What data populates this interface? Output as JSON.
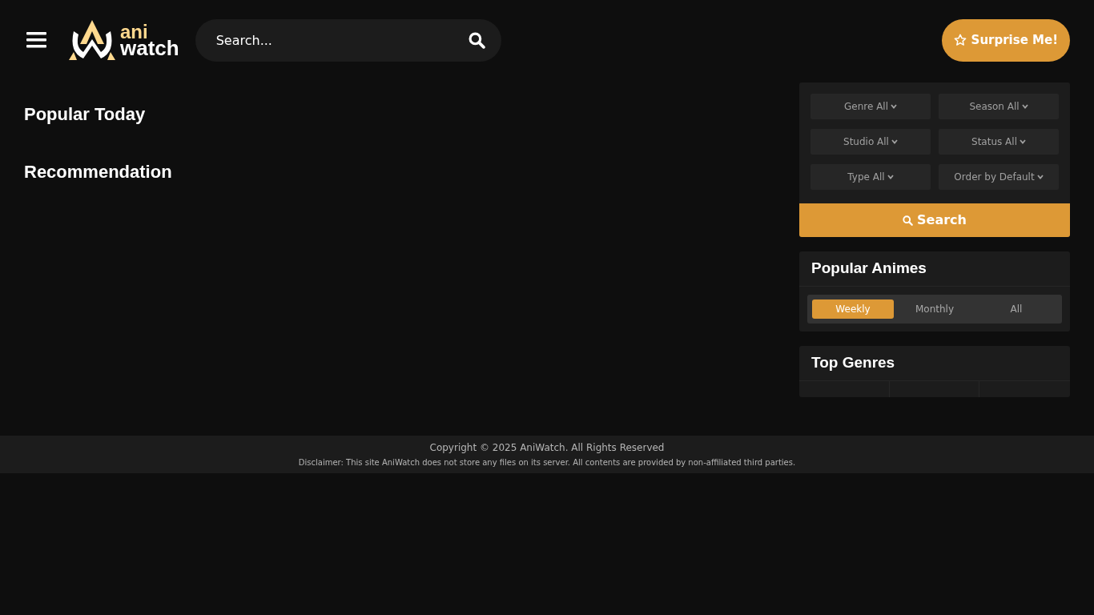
{
  "header": {
    "logo": {
      "top": "ani",
      "bottom": "watch"
    },
    "search": {
      "placeholder": "Search..."
    },
    "surprise_button": "Surprise Me!"
  },
  "main": {
    "sections": [
      "Popular Today",
      "Recommendation"
    ]
  },
  "filters": {
    "dropdowns": [
      "Genre All",
      "Season All",
      "Studio All",
      "Status All",
      "Type All",
      "Order by Default"
    ],
    "search_button": "Search"
  },
  "popular_animes": {
    "title": "Popular Animes",
    "tabs": [
      {
        "label": "Weekly",
        "selected": true
      },
      {
        "label": "Monthly",
        "selected": false
      },
      {
        "label": "All",
        "selected": false
      }
    ]
  },
  "top_genres": {
    "title": "Top Genres"
  },
  "footer": {
    "copyright": "Copyright © 2025 AniWatch. All Rights Reserved",
    "disclaimer": "Disclaimer: This site AniWatch does not store any files on its server. All contents are provided by non-affiliated third parties."
  }
}
